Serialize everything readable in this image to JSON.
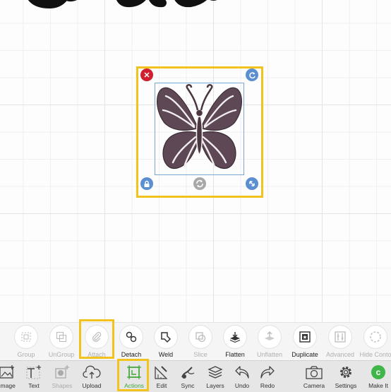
{
  "canvas": {
    "selection_handles": {
      "delete_icon": "close-icon",
      "rotate_icon": "rotate-icon",
      "lock_icon": "lock-icon",
      "scale_icon": "scale-arrow-icon",
      "flip_icon": "flip-icon"
    },
    "image_fill_color": "#5f4856",
    "selection_highlight_color": "#f2c31c"
  },
  "actions_toolbar": {
    "items": [
      {
        "label": "Group",
        "icon": "group-icon",
        "enabled": false
      },
      {
        "label": "UnGroup",
        "icon": "ungroup-icon",
        "enabled": false
      },
      {
        "label": "Attach",
        "icon": "paperclip-icon",
        "enabled": false,
        "highlighted": true
      },
      {
        "label": "Detach",
        "icon": "detach-icon",
        "enabled": true
      },
      {
        "label": "Weld",
        "icon": "weld-icon",
        "enabled": true
      },
      {
        "label": "Slice",
        "icon": "slice-icon",
        "enabled": false
      },
      {
        "label": "Flatten",
        "icon": "flatten-icon",
        "enabled": true
      },
      {
        "label": "Unflatten",
        "icon": "unflatten-icon",
        "enabled": false
      },
      {
        "label": "Duplicate",
        "icon": "duplicate-icon",
        "enabled": true
      },
      {
        "label": "Advanced",
        "icon": "advanced-icon",
        "enabled": false
      },
      {
        "label": "Hide Conto",
        "icon": "hide-contour-icon",
        "enabled": false
      }
    ]
  },
  "main_toolbar": {
    "items": [
      {
        "label": "Image",
        "icon": "image-icon"
      },
      {
        "label": "Text",
        "icon": "text-icon"
      },
      {
        "label": "Shapes",
        "icon": "shapes-icon",
        "dim": true
      },
      {
        "label": "Upload",
        "icon": "upload-icon"
      },
      {
        "label": "Actions",
        "icon": "actions-icon",
        "highlighted": true,
        "accent": "#3fa535"
      },
      {
        "label": "Edit",
        "icon": "edit-icon"
      },
      {
        "label": "Sync",
        "icon": "sync-icon"
      },
      {
        "label": "Layers",
        "icon": "layers-icon"
      },
      {
        "label": "Undo",
        "icon": "undo-icon"
      },
      {
        "label": "Redo",
        "icon": "redo-icon"
      },
      {
        "label": "Camera",
        "icon": "camera-icon"
      },
      {
        "label": "Settings",
        "icon": "settings-icon"
      },
      {
        "label": "Make It",
        "icon": "make-it-icon",
        "accent": "#3fb54a"
      }
    ]
  }
}
